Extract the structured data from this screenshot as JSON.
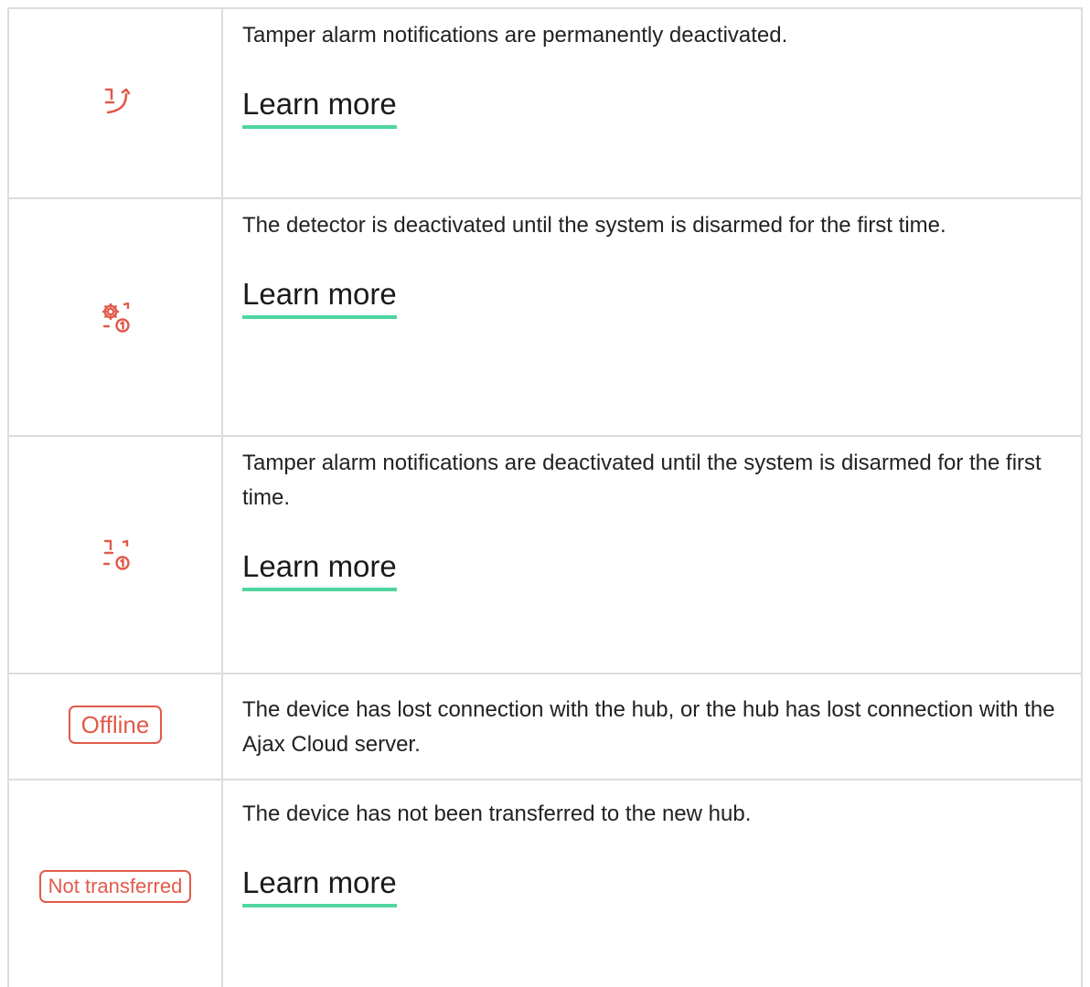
{
  "colors": {
    "icon_red": "#e15a4a",
    "link_underline": "#4fd6a1",
    "border": "#dcdcdc",
    "text": "#222222"
  },
  "rows": [
    {
      "icon": "tamper-deactivated-icon",
      "description": "Tamper alarm notifications are permanently deactivated.",
      "link": "Learn more"
    },
    {
      "icon": "gear-deactivated-until-disarm-icon",
      "description": "The detector is deactivated until the system is disarmed for the first time.",
      "link": "Learn more"
    },
    {
      "icon": "tamper-deactivated-until-disarm-icon",
      "description": "Tamper alarm notifications are deactivated until the system is disarmed for the first time.",
      "link": "Learn more"
    },
    {
      "badge": "Offline",
      "description": "The device has lost connection with the hub, or the hub has lost connection with the Ajax Cloud server."
    },
    {
      "badge": "Not transferred",
      "description": "The device has not been transferred to the new hub.",
      "link": "Learn more"
    }
  ]
}
